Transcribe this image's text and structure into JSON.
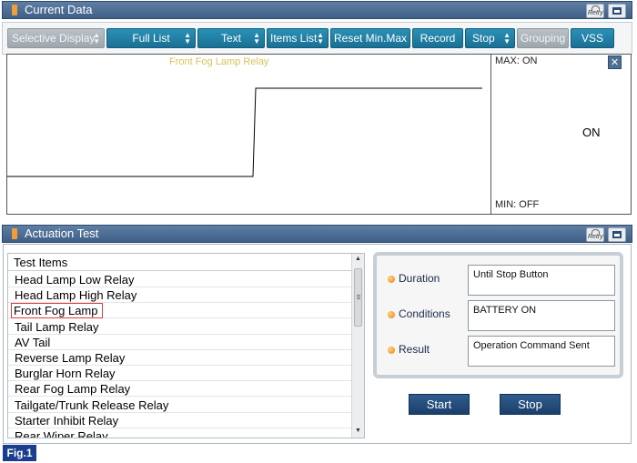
{
  "current_data": {
    "title": "Current Data",
    "retry_label": "Retry",
    "toolbar": {
      "selective_display": "Selective Display",
      "full_list": "Full List",
      "text": "Text",
      "items_list": "Items List",
      "reset_min_max": "Reset Min.Max",
      "record": "Record",
      "stop": "Stop",
      "grouping": "Grouping",
      "vss": "VSS"
    },
    "graph": {
      "title": "Front Fog Lamp Relay",
      "max_label": "MAX: ON",
      "min_label": "MIN: OFF",
      "current_value": "ON",
      "line_color": "#000000",
      "title_color": "#d8c25c"
    }
  },
  "actuation_test": {
    "title": "Actuation Test",
    "retry_label": "Retry",
    "list_header": "Test Items",
    "items": [
      "Head Lamp Low Relay",
      "Head Lamp High Relay",
      "Front Fog Lamp",
      "Tail Lamp Relay",
      "AV Tail",
      "Reverse Lamp Relay",
      "Burglar Horn Relay",
      "Rear Fog Lamp Relay",
      "Tailgate/Trunk Release Relay",
      "Starter Inhibit Relay",
      "Rear Wiper Relay"
    ],
    "selected_item": "Front Fog Lamp",
    "duration_label": "Duration",
    "duration_value": "Until Stop Button",
    "conditions_label": "Conditions",
    "conditions_value": "BATTERY ON",
    "result_label": "Result",
    "result_value": "Operation Command Sent",
    "start_label": "Start",
    "stop_label": "Stop"
  },
  "figure_label": "Fig.1",
  "colors": {
    "header_blue": "#4a6b92",
    "button_teal": "#1f82a8",
    "button_disabled": "#aab3ba",
    "selection_red": "#e23b3b",
    "action_button": "#254d7c",
    "fig_badge": "#1a3d8f"
  }
}
